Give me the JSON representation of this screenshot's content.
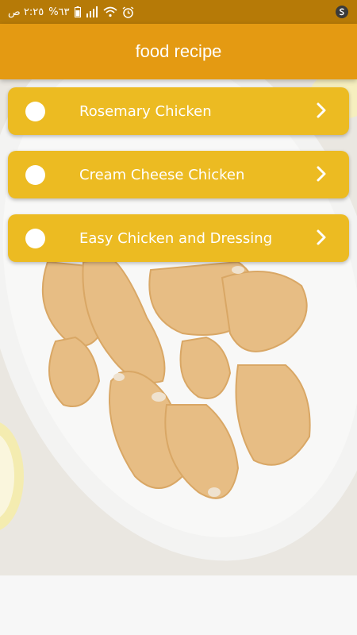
{
  "status_bar": {
    "time": "٢:٢٥ ص",
    "battery": "%٦٣",
    "icons": [
      "alarm-icon",
      "wifi-icon",
      "signal-icon",
      "battery-icon",
      "s-app-icon"
    ]
  },
  "app_bar": {
    "title": "food recipe"
  },
  "recipes": [
    {
      "label": "Rosemary Chicken"
    },
    {
      "label": "Cream Cheese Chicken"
    },
    {
      "label": "Easy Chicken and Dressing"
    }
  ],
  "colors": {
    "status_bar": "#b67a07",
    "app_bar": "#e49a12",
    "item_bg": "#ecbb22",
    "item_text": "#ffffff"
  }
}
